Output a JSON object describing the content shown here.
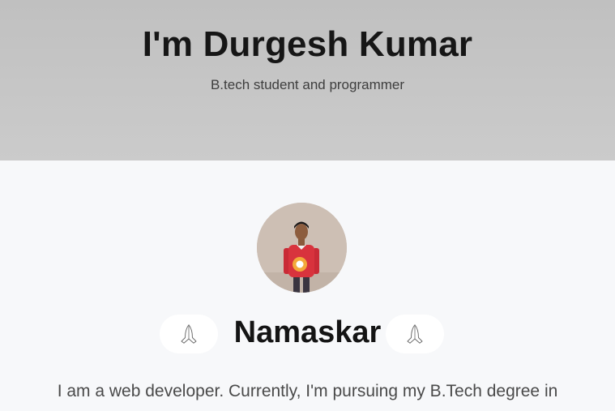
{
  "header": {
    "title": "I'm Durgesh Kumar",
    "subtitle": "B.tech student and programmer"
  },
  "profile": {
    "avatar_icon": "profile-photo",
    "greeting": "Namaskar",
    "greeting_icon": "folded-hands-icon",
    "intro": "I am a web developer. Currently, I'm pursuing my B.Tech degree in"
  },
  "colors": {
    "hero_bg": "#c4c4c4",
    "page_bg": "#f7f8fa",
    "shirt": "#d8333d"
  }
}
